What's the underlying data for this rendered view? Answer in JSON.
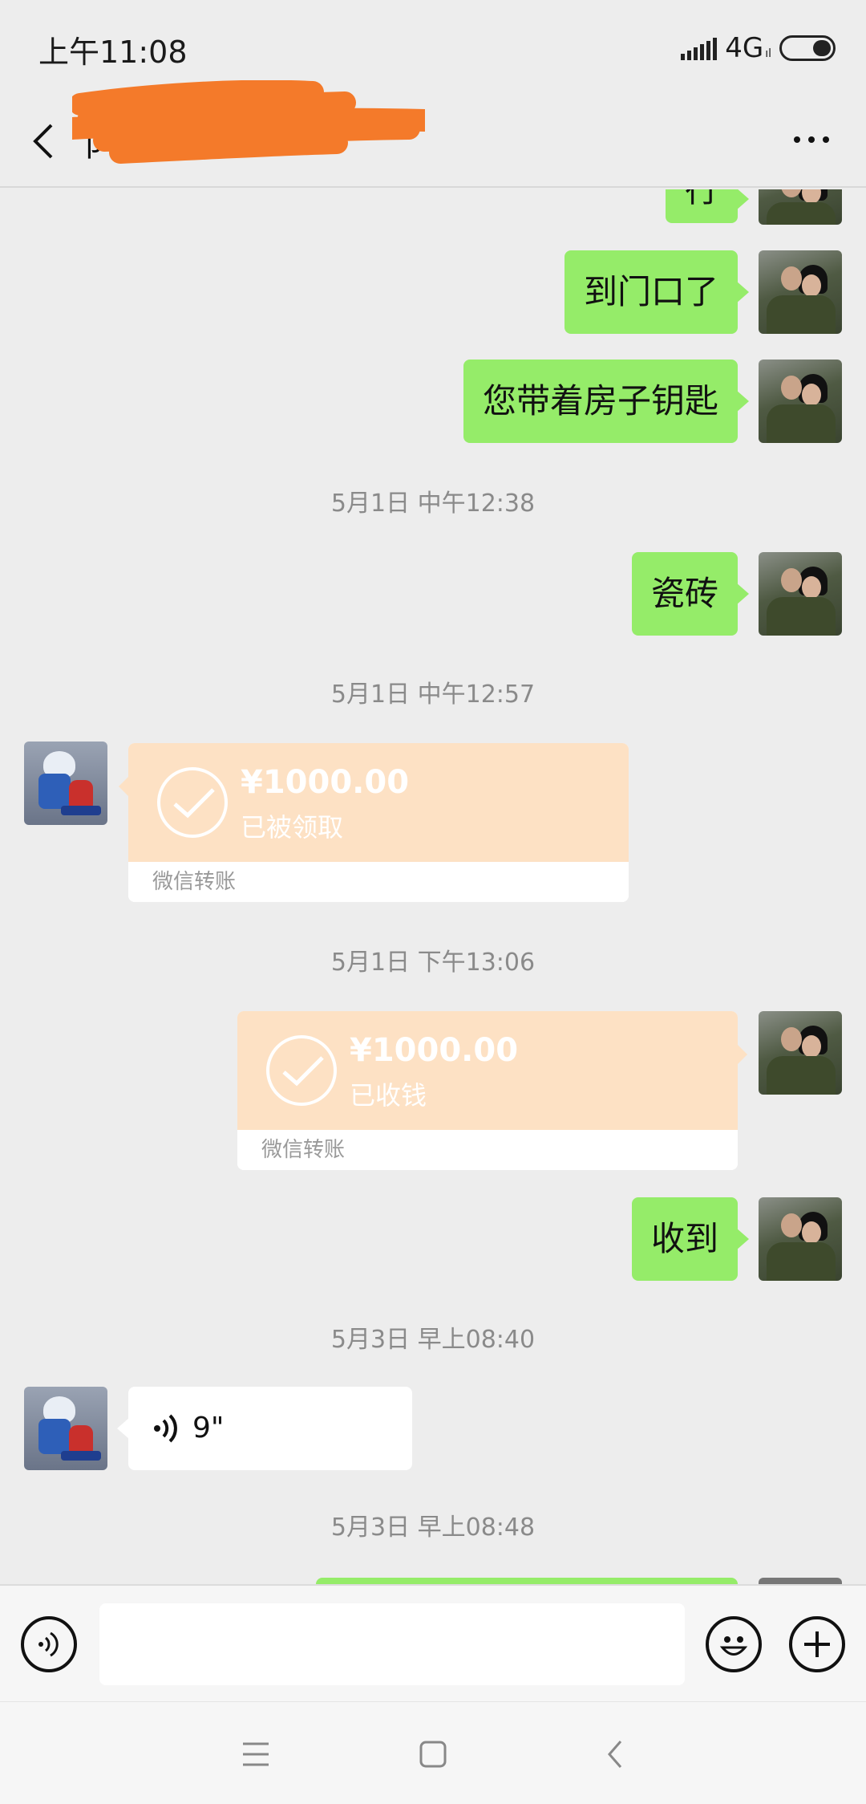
{
  "status_bar": {
    "time": "上午11:08",
    "network": "4G",
    "network_sub": "ıl",
    "icons": [
      "signal-icon",
      "battery-icon"
    ]
  },
  "nav": {
    "title": "阝                  界",
    "back_icon": "chevron-left-icon",
    "more_icon": "more-horizontal-icon"
  },
  "messages": {
    "m0": {
      "text": "行",
      "side": "right"
    },
    "m1": {
      "text": "到门口了",
      "side": "right"
    },
    "m2": {
      "text": "您带着房子钥匙",
      "side": "right"
    },
    "t1": "5月1日 中午12:38",
    "m3": {
      "text": "瓷砖",
      "side": "right"
    },
    "t2": "5月1日 中午12:57",
    "transfer1": {
      "amount": "¥1000.00",
      "status": "已被领取",
      "label": "微信转账",
      "side": "left"
    },
    "t3": "5月1日 下午13:06",
    "transfer2": {
      "amount": "¥1000.00",
      "status": "已收钱",
      "label": "微信转账",
      "side": "right"
    },
    "m4": {
      "text": "收到",
      "side": "right"
    },
    "t4": "5月3日 早上08:40",
    "voice": {
      "duration": "9\"",
      "side": "left",
      "icon": "voice-wave-icon"
    },
    "t5": "5月3日 早上08:48"
  },
  "input_bar": {
    "placeholder": "",
    "icons": [
      "voice-icon",
      "emoji-icon",
      "plus-icon"
    ]
  },
  "system_nav": {
    "icons": [
      "menu-icon",
      "home-icon",
      "back-icon"
    ]
  },
  "colors": {
    "background": "#ededed",
    "green_bubble": "#95ec69",
    "transfer_orange": "#fde1c4",
    "scribble": "#f47a2a"
  }
}
